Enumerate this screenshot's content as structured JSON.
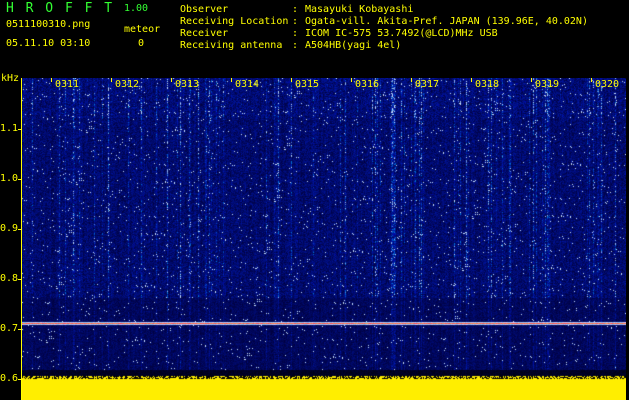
{
  "header": {
    "app_title": "H R O F F T",
    "app_version": "1.00",
    "filename": "0511100310.png",
    "datetime": "05.11.10 03:10",
    "meteor_label": "meteor",
    "meteor_count": "0",
    "info": [
      {
        "label": "Observer",
        "value": "Masayuki Kobayashi"
      },
      {
        "label": "Receiving Location",
        "value": "Ogata-vill. Akita-Pref. JAPAN (139.96E, 40.02N)"
      },
      {
        "label": "Receiver",
        "value": "ICOM IC-575 53.7492(@LCD)MHz USB"
      },
      {
        "label": "Receiving antenna",
        "value": "A504HB(yagi 4el)"
      }
    ]
  },
  "spectrogram": {
    "frequency_unit": "kHz",
    "y_ticks": [
      "1.1",
      "1.0",
      "0.9",
      "0.8",
      "0.7",
      "0.6"
    ],
    "x_ticks": [
      "0311",
      "0312",
      "0313",
      "0314",
      "0315",
      "0316",
      "0317",
      "0318",
      "0319",
      "0320"
    ],
    "colors": {
      "background": "#000000",
      "noise_low": "#000a4d",
      "noise_high": "#1a6cff",
      "carrier": "#ff3333",
      "power_band": "#ffff00",
      "axis": "#ffff00"
    }
  }
}
